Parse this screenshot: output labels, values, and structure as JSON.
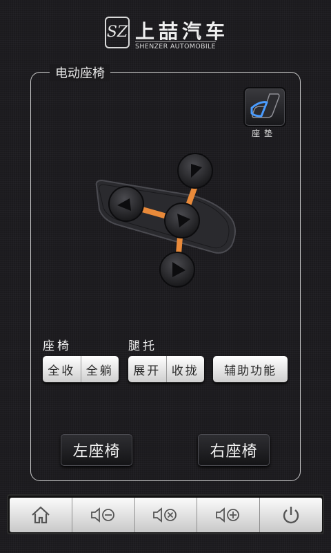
{
  "header": {
    "logo_mark": "SZ",
    "brand_cn": "上喆汽车",
    "brand_en": "SHENZER AUTOMOBILE"
  },
  "panel": {
    "title": "电动座椅"
  },
  "cushion": {
    "label": "座垫",
    "icon": "seat-cushion-icon"
  },
  "seat_control": {
    "arrows": [
      "up-right-arrow",
      "left-arrow",
      "center-arrow",
      "down-arrow"
    ],
    "accent_color": "#e98a3a"
  },
  "seat_group": {
    "label": "座椅",
    "buttons": [
      "全收",
      "全躺"
    ]
  },
  "leg_group": {
    "label": "腿托",
    "buttons": [
      "展开",
      "收拢"
    ]
  },
  "aux": {
    "label": "辅助功能"
  },
  "sides": {
    "left": "左座椅",
    "right": "右座椅"
  },
  "bottom_nav": [
    "home-icon",
    "volume-down-icon",
    "mute-icon",
    "volume-up-icon",
    "power-icon"
  ]
}
